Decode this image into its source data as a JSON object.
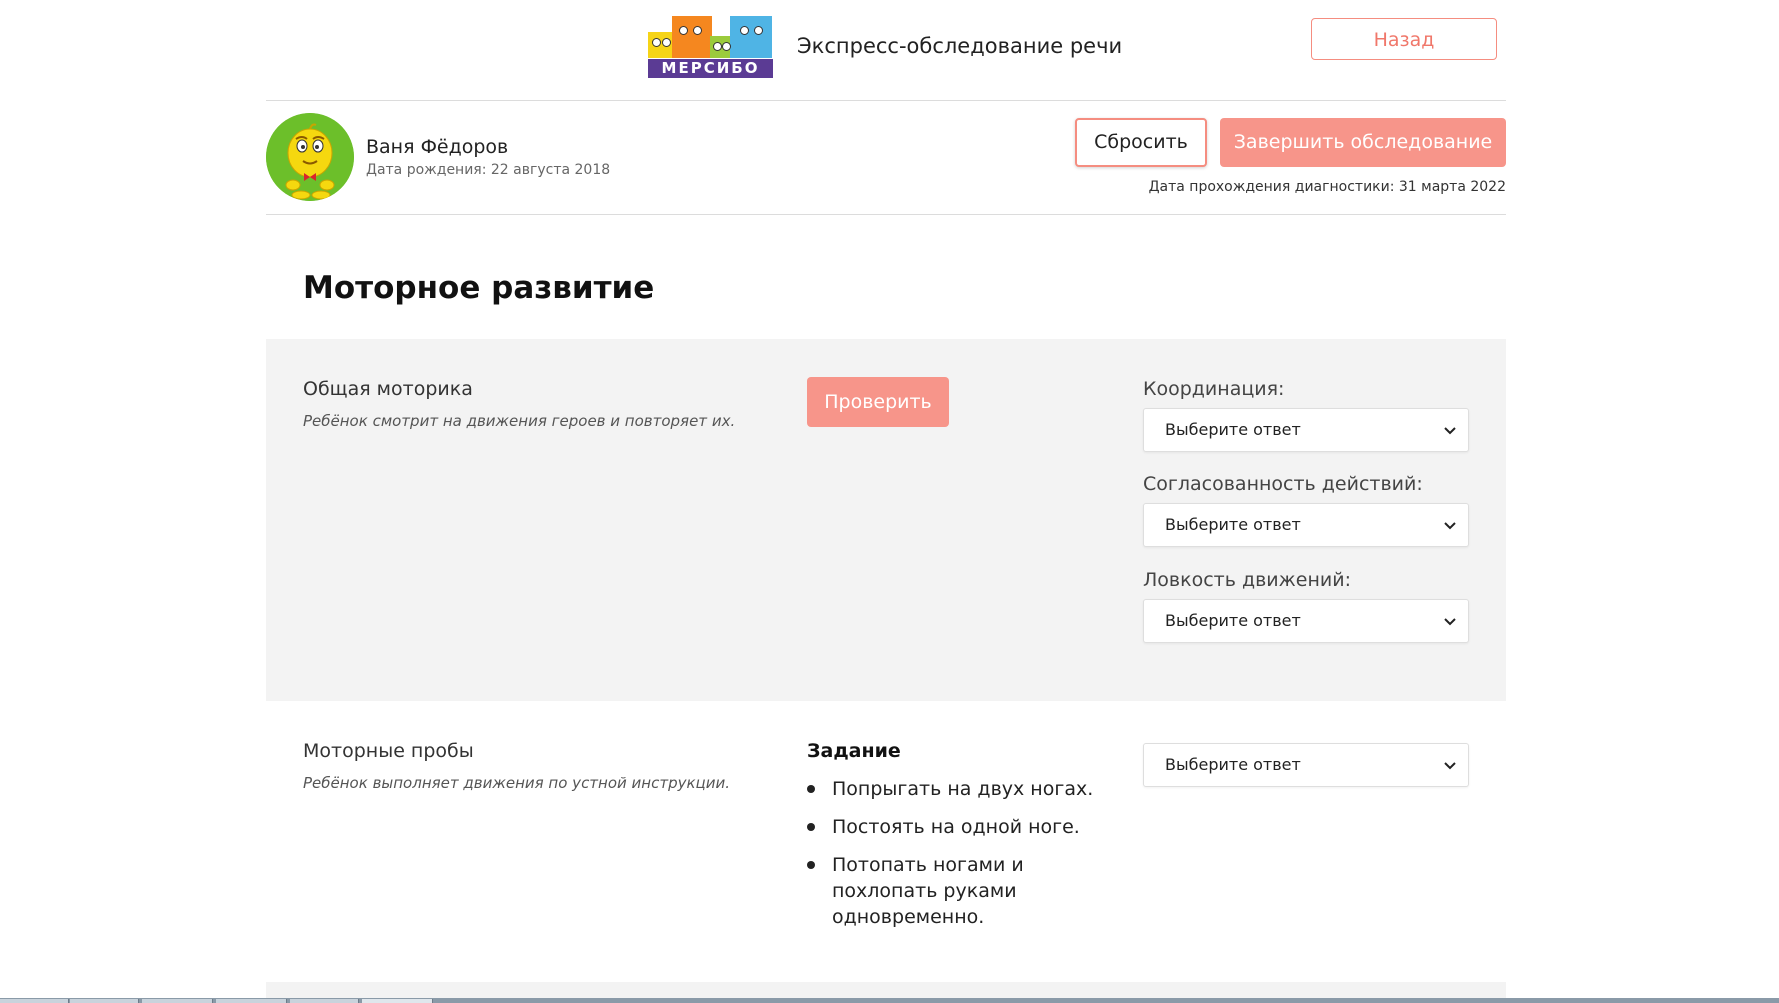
{
  "header": {
    "logo_text": "МЕРСИБО",
    "app_title": "Экспресс-обследование речи",
    "back_label": "Назад"
  },
  "patient": {
    "name": "Ваня Фёдоров",
    "birth_date": "Дата рождения: 22 августа 2018",
    "reset_label": "Сбросить",
    "finish_label": "Завершить обследование",
    "diagnostic_date": "Дата прохождения диагностики: 31 марта 2022"
  },
  "section": {
    "title": "Моторное развитие",
    "general_motor": {
      "title": "Общая моторика",
      "description": "Ребёнок смотрит на движения героев и повторяет их.",
      "check_label": "Проверить",
      "fields": [
        {
          "label": "Координация:",
          "value": "Выберите ответ"
        },
        {
          "label": "Согласованность действий:",
          "value": "Выберите ответ"
        },
        {
          "label": "Ловкость движений:",
          "value": "Выберите ответ"
        }
      ]
    },
    "motor_tests": {
      "title": "Моторные пробы",
      "description": "Ребёнок выполняет движения по устной инструкции.",
      "task_title": "Задание",
      "tasks": [
        "Попрыгать на двух ногах.",
        "Постоять на одной ноге.",
        "Потопать ногами и похлопать руками одновременно."
      ],
      "select_value": "Выберите ответ"
    }
  },
  "colors": {
    "accent": "#f7958a",
    "accent_border": "#f58d80",
    "panel_bg": "#f3f3f3",
    "logo_plate": "#5b3b94"
  },
  "icons": {
    "select_arrow": "chevron-down-icon",
    "avatar": "smiley-character-avatar"
  }
}
